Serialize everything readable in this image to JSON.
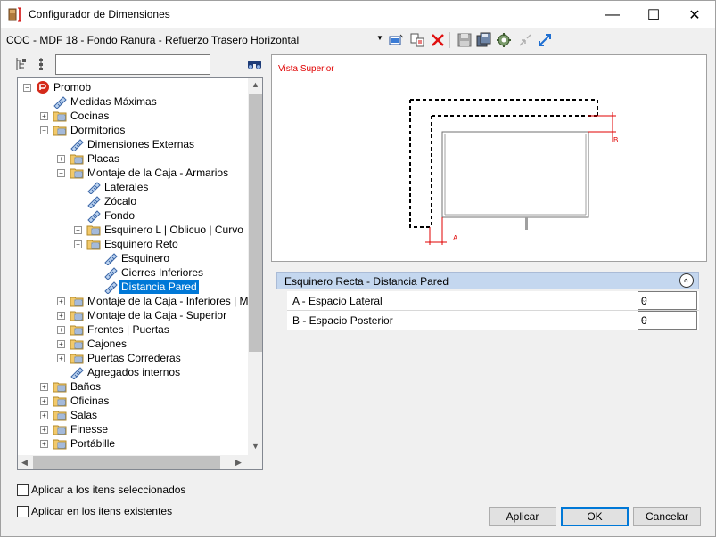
{
  "window": {
    "title": "Configurador de Dimensiones",
    "minimize": "—",
    "maximize": "☐",
    "close": "✕"
  },
  "toolbar": {
    "combo_value": "COC - MDF 18 - Fondo Ranura - Refuerzo Trasero Horizontal",
    "combo_arrow": "▼"
  },
  "search": {
    "value": ""
  },
  "tree": {
    "rows": [
      {
        "label": "Promob",
        "level": 0,
        "expander": "−",
        "icon": "promob-logo-icon",
        "selected": false
      },
      {
        "label": "Medidas Máximas",
        "level": 1,
        "expander": "",
        "icon": "dimension-tag-icon",
        "selected": false
      },
      {
        "label": "Cocinas",
        "level": 1,
        "expander": "+",
        "icon": "folder-icon",
        "selected": false
      },
      {
        "label": "Dormitorios",
        "level": 1,
        "expander": "−",
        "icon": "folder-icon",
        "selected": false
      },
      {
        "label": "Dimensiones Externas",
        "level": 2,
        "expander": "",
        "icon": "dimension-tag-icon",
        "selected": false
      },
      {
        "label": "Placas",
        "level": 2,
        "expander": "+",
        "icon": "folder-icon",
        "selected": false
      },
      {
        "label": "Montaje de la Caja - Armarios",
        "level": 2,
        "expander": "−",
        "icon": "folder-icon",
        "selected": false
      },
      {
        "label": "Laterales",
        "level": 3,
        "expander": "",
        "icon": "dimension-tag-icon",
        "selected": false
      },
      {
        "label": "Zócalo",
        "level": 3,
        "expander": "",
        "icon": "dimension-tag-icon",
        "selected": false
      },
      {
        "label": "Fondo",
        "level": 3,
        "expander": "",
        "icon": "dimension-tag-icon",
        "selected": false
      },
      {
        "label": "Esquinero L | Oblicuo | Curvo",
        "level": 3,
        "expander": "+",
        "icon": "folder-icon",
        "selected": false
      },
      {
        "label": "Esquinero Reto",
        "level": 3,
        "expander": "−",
        "icon": "folder-icon",
        "selected": false
      },
      {
        "label": "Esquinero",
        "level": 4,
        "expander": "",
        "icon": "dimension-tag-icon",
        "selected": false
      },
      {
        "label": "Cierres Inferiores",
        "level": 4,
        "expander": "",
        "icon": "dimension-tag-icon",
        "selected": false
      },
      {
        "label": "Distancia Pared",
        "level": 4,
        "expander": "",
        "icon": "dimension-tag-icon",
        "selected": true
      },
      {
        "label": "Montaje de la Caja - Inferiores | Mesa",
        "level": 2,
        "expander": "+",
        "icon": "folder-icon",
        "selected": false
      },
      {
        "label": "Montaje de la Caja - Superior",
        "level": 2,
        "expander": "+",
        "icon": "folder-icon",
        "selected": false
      },
      {
        "label": "Frentes | Puertas",
        "level": 2,
        "expander": "+",
        "icon": "folder-icon",
        "selected": false
      },
      {
        "label": "Cajones",
        "level": 2,
        "expander": "+",
        "icon": "folder-icon",
        "selected": false
      },
      {
        "label": "Puertas Correderas",
        "level": 2,
        "expander": "+",
        "icon": "folder-icon",
        "selected": false
      },
      {
        "label": "Agregados internos",
        "level": 2,
        "expander": "",
        "icon": "dimension-tag-icon",
        "selected": false
      },
      {
        "label": "Baños",
        "level": 1,
        "expander": "+",
        "icon": "folder-icon",
        "selected": false
      },
      {
        "label": "Oficinas",
        "level": 1,
        "expander": "+",
        "icon": "folder-icon",
        "selected": false
      },
      {
        "label": "Salas",
        "level": 1,
        "expander": "+",
        "icon": "folder-icon",
        "selected": false
      },
      {
        "label": "Finesse",
        "level": 1,
        "expander": "+",
        "icon": "folder-icon",
        "selected": false
      },
      {
        "label": "Portábille",
        "level": 1,
        "expander": "+",
        "icon": "folder-icon",
        "selected": false
      }
    ]
  },
  "preview": {
    "view_label": "Vista Superior",
    "dim_a": "A",
    "dim_b": "B"
  },
  "properties": {
    "section_title": "Esquinero Recta - Distancia Pared",
    "collapse_glyph": "«",
    "rows": [
      {
        "name": "A - Espacio Lateral",
        "value": "0"
      },
      {
        "name": "B - Espacio Posterior",
        "value": "0"
      }
    ]
  },
  "options": {
    "apply_selected": "Aplicar a los itens seleccionados",
    "apply_existing": "Aplicar en los itens existentes"
  },
  "buttons": {
    "apply": "Aplicar",
    "ok": "OK",
    "cancel": "Cancelar"
  },
  "colors": {
    "selection": "#0078d7",
    "section_header": "#c4d7ef",
    "dimension_red": "#e00000"
  }
}
